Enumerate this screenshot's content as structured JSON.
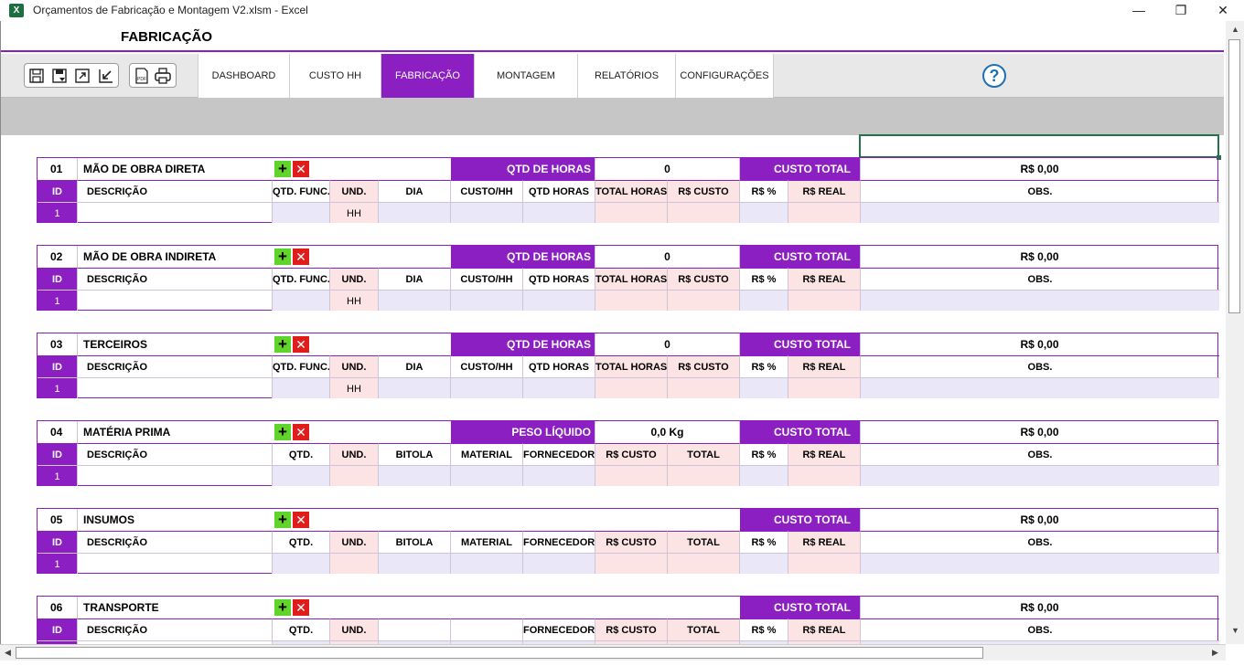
{
  "window": {
    "title": "Orçamentos de Fabricação e Montagem V2.xlsm  -  Excel",
    "app_icon": "X",
    "minimize": "—",
    "restore": "❐",
    "close": "✕"
  },
  "page_title": "FABRICAÇÃO",
  "tabs": [
    {
      "label": "DASHBOARD",
      "active": false
    },
    {
      "label": "CUSTO HH",
      "active": false
    },
    {
      "label": "FABRICAÇÃO",
      "active": true
    },
    {
      "label": "MONTAGEM",
      "active": false
    },
    {
      "label": "RELATÓRIOS",
      "active": false
    },
    {
      "label": "CONFIGURAÇÕES",
      "active": false
    }
  ],
  "toolbar_icons": [
    "save-icon",
    "save-as-icon",
    "expand-icon",
    "collapse-icon",
    "pdf-icon",
    "print-icon"
  ],
  "help_label": "?",
  "add_glyph": "+",
  "delete_glyph": "✕",
  "colors": {
    "accent": "#8b1fc2",
    "lavender": "#eae8f8",
    "pink": "#fde4e4",
    "add": "#5fd52c",
    "delete": "#e21b1b",
    "help": "#1f6fb5"
  },
  "sections": [
    {
      "num": "01",
      "title": "MÃO DE OBRA DIRETA",
      "metric_label": "QTD DE HORAS",
      "metric_value": "0",
      "total_label": "CUSTO TOTAL",
      "total_value": "R$ 0,00",
      "cols": [
        "ID",
        "DESCRIÇÃO",
        "QTD. FUNC.",
        "UND.",
        "DIA",
        "CUSTO/HH",
        "QTD HORAS",
        "TOTAL HORAS",
        "R$ CUSTO",
        "R$ %",
        "R$ REAL",
        "OBS."
      ],
      "row": {
        "id": "1",
        "und": "HH"
      }
    },
    {
      "num": "02",
      "title": "MÃO DE OBRA INDIRETA",
      "metric_label": "QTD DE HORAS",
      "metric_value": "0",
      "total_label": "CUSTO TOTAL",
      "total_value": "R$ 0,00",
      "cols": [
        "ID",
        "DESCRIÇÃO",
        "QTD. FUNC.",
        "UND.",
        "DIA",
        "CUSTO/HH",
        "QTD HORAS",
        "TOTAL HORAS",
        "R$ CUSTO",
        "R$ %",
        "R$ REAL",
        "OBS."
      ],
      "row": {
        "id": "1",
        "und": "HH"
      }
    },
    {
      "num": "03",
      "title": "TERCEIROS",
      "metric_label": "QTD DE HORAS",
      "metric_value": "0",
      "total_label": "CUSTO TOTAL",
      "total_value": "R$ 0,00",
      "cols": [
        "ID",
        "DESCRIÇÃO",
        "QTD. FUNC.",
        "UND.",
        "DIA",
        "CUSTO/HH",
        "QTD HORAS",
        "TOTAL HORAS",
        "R$ CUSTO",
        "R$ %",
        "R$ REAL",
        "OBS."
      ],
      "row": {
        "id": "1",
        "und": "HH"
      }
    },
    {
      "num": "04",
      "title": "MATÉRIA PRIMA",
      "metric_label": "PESO LÍQUIDO",
      "metric_value": "0,0 Kg",
      "total_label": "CUSTO TOTAL",
      "total_value": "R$ 0,00",
      "cols": [
        "ID",
        "DESCRIÇÃO",
        "QTD.",
        "UND.",
        "BITOLA",
        "MATERIAL",
        "FORNECEDOR",
        "R$ CUSTO",
        "TOTAL",
        "R$ %",
        "R$ REAL",
        "OBS."
      ],
      "row": {
        "id": "1",
        "und": ""
      }
    },
    {
      "num": "05",
      "title": "INSUMOS",
      "metric_label": "",
      "metric_value": "",
      "total_label": "CUSTO TOTAL",
      "total_value": "R$ 0,00",
      "cols": [
        "ID",
        "DESCRIÇÃO",
        "QTD.",
        "UND.",
        "BITOLA",
        "MATERIAL",
        "FORNECEDOR",
        "R$ CUSTO",
        "TOTAL",
        "R$ %",
        "R$ REAL",
        "OBS."
      ],
      "row": {
        "id": "1",
        "und": ""
      }
    },
    {
      "num": "06",
      "title": "TRANSPORTE",
      "metric_label": "",
      "metric_value": "",
      "total_label": "CUSTO TOTAL",
      "total_value": "R$ 0,00",
      "cols": [
        "ID",
        "DESCRIÇÃO",
        "QTD.",
        "UND.",
        "",
        "",
        "FORNECEDOR",
        "R$ CUSTO",
        "TOTAL",
        "R$ %",
        "R$ REAL",
        "OBS."
      ],
      "row": {
        "id": "",
        "und": ""
      }
    }
  ]
}
